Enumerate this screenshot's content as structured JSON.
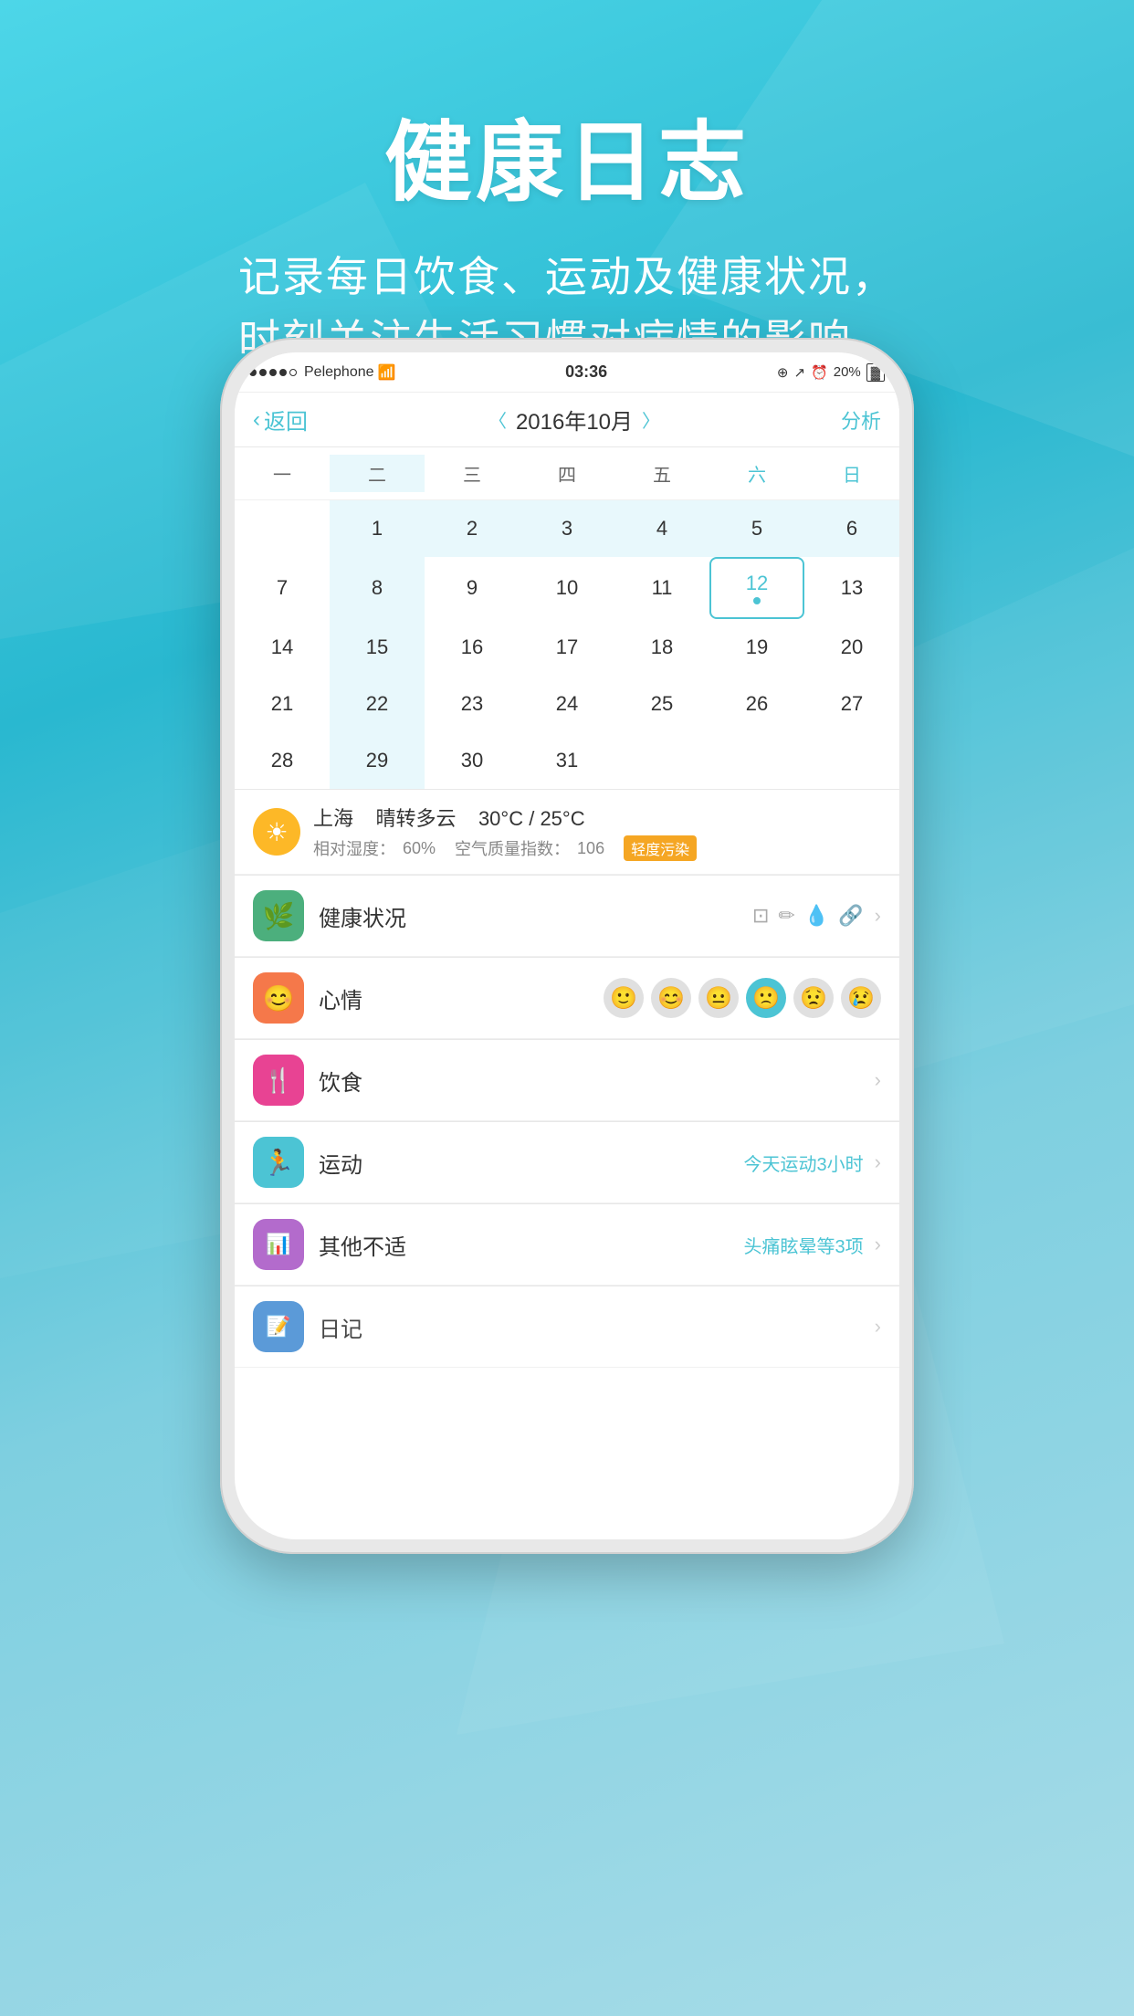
{
  "background": {
    "gradient_start": "#4dd6e8",
    "gradient_end": "#29b8d0"
  },
  "header": {
    "title": "健康日志",
    "subtitle_line1": "记录每日饮食、运动及健康状况，",
    "subtitle_line2": "时刻关注生活习惯对病情的影响。"
  },
  "status_bar": {
    "carrier": "Pelephone",
    "signal_dots": 4,
    "wifi": "wifi",
    "time": "03:36",
    "battery": "20%"
  },
  "nav": {
    "back_label": "返回",
    "title": "2016年10月",
    "action_label": "分析",
    "prev_arrow": "〈",
    "next_arrow": "〉"
  },
  "calendar": {
    "weekdays": [
      "一",
      "二",
      "三",
      "四",
      "五",
      "六",
      "日"
    ],
    "weeks": [
      [
        "",
        "1",
        "2",
        "3",
        "4",
        "5",
        "6"
      ],
      [
        "7",
        "8",
        "9",
        "10",
        "11",
        "12",
        "13"
      ],
      [
        "14",
        "15",
        "16",
        "17",
        "18",
        "19",
        "20"
      ],
      [
        "21",
        "22",
        "23",
        "24",
        "25",
        "26",
        "27"
      ],
      [
        "28",
        "29",
        "30",
        "31",
        "",
        "",
        ""
      ]
    ],
    "today_date": "12",
    "highlighted_col": 1
  },
  "weather": {
    "city": "上海",
    "condition": "晴转多云",
    "temp_high": "30°C",
    "temp_low": "25°C",
    "humidity_label": "相对湿度：",
    "humidity": "60%",
    "aqi_label": "空气质量指数：",
    "aqi": "106",
    "pollution_badge": "轻度污染"
  },
  "list_items": [
    {
      "id": "health",
      "label": "健康状况",
      "icon_color": "green",
      "icon_char": "🌿",
      "has_icons": true,
      "value": ""
    },
    {
      "id": "mood",
      "label": "心情",
      "icon_color": "orange",
      "icon_char": "😊",
      "has_mood": true,
      "value": ""
    },
    {
      "id": "diet",
      "label": "饮食",
      "icon_color": "pink",
      "icon_char": "🍴",
      "value": ""
    },
    {
      "id": "exercise",
      "label": "运动",
      "icon_color": "teal",
      "icon_char": "🏃",
      "value": "今天运动3小时"
    },
    {
      "id": "discomfort",
      "label": "其他不适",
      "icon_color": "purple",
      "icon_char": "📊",
      "value": "头痛眩晕等3项"
    },
    {
      "id": "diary",
      "label": "日记",
      "icon_color": "blue",
      "icon_char": "📝",
      "value": ""
    }
  ],
  "mood_faces": [
    "😊",
    "🙂",
    "😐",
    "🙁",
    "😟",
    "😢"
  ],
  "mood_active_index": 3,
  "icons": {
    "back_chevron": "‹",
    "chevron_right": "›",
    "sun": "☀"
  }
}
